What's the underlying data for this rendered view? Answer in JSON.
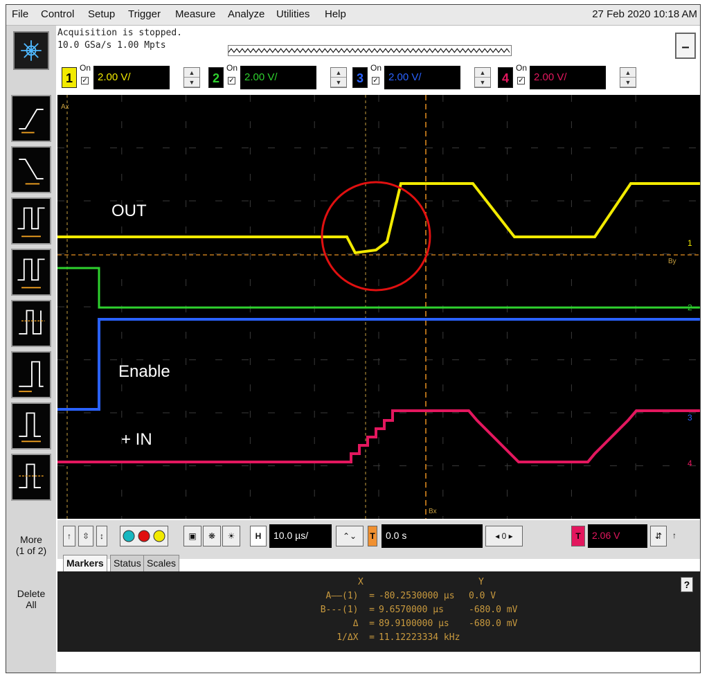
{
  "menu": {
    "items": [
      "File",
      "Control",
      "Setup",
      "Trigger",
      "Measure",
      "Analyze",
      "Utilities",
      "Help"
    ],
    "datetime": "27 Feb 2020 10:18 AM"
  },
  "acquisition": {
    "status": "Acquisition is stopped.",
    "rate": "10.0 GSa/s  1.00 Mpts"
  },
  "channels": [
    {
      "num": "1",
      "on_label": "On",
      "checked": true,
      "scale": "2.00 V/",
      "color": "#f2ea00"
    },
    {
      "num": "2",
      "on_label": "On",
      "checked": true,
      "scale": "2.00 V/",
      "color": "#2ed12e"
    },
    {
      "num": "3",
      "on_label": "On",
      "checked": true,
      "scale": "2.00 V/",
      "color": "#2a62ff"
    },
    {
      "num": "4",
      "on_label": "On",
      "checked": true,
      "scale": "2.00 V/",
      "color": "#e3175e"
    }
  ],
  "overlay_labels": {
    "out": "OUT",
    "enable": "Enable",
    "in": "+ IN"
  },
  "sidebar": {
    "more": "More",
    "more_page": "(1 of 2)",
    "delete": "Delete",
    "delete_all": "All"
  },
  "horizontal": {
    "h_label": "H",
    "timebase": "10.0 µs/",
    "delay": "0.0 s",
    "ref_value": "0"
  },
  "trigger": {
    "t_label": "T",
    "level": "2.06 V"
  },
  "tabs": [
    "Markers",
    "Status",
    "Scales"
  ],
  "markers": {
    "header_x": "X",
    "header_y": "Y",
    "rows": [
      {
        "label": "A——(1)  =",
        "x": "-80.2530000 µs",
        "y": "0.0 V"
      },
      {
        "label": "B---(1)  =",
        "x": "9.6570000 µs",
        "y": "-680.0 mV"
      },
      {
        "label": "Δ  =",
        "x": "89.9100000 µs",
        "y": "-680.0 mV"
      },
      {
        "label": "1/ΔX  =",
        "x": "11.12223334 kHz",
        "y": ""
      }
    ]
  },
  "screen_marks": {
    "ax_label": "Ax",
    "bx_label": "Bx",
    "by_label": "By",
    "ch1_marker": "1",
    "ch2_marker": "2",
    "ch3_marker": "3",
    "ch4_marker": "4"
  },
  "help_label": "?",
  "minimize_label": "–"
}
